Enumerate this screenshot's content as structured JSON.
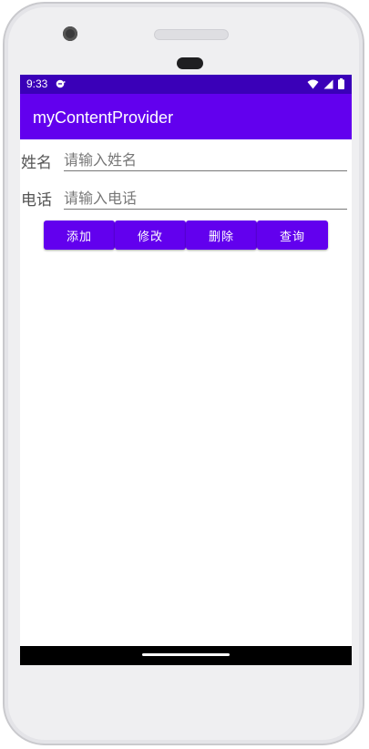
{
  "status_bar": {
    "time": "9:33"
  },
  "app_bar": {
    "title": "myContentProvider"
  },
  "form": {
    "name_label": "姓名",
    "name_placeholder": "请输入姓名",
    "phone_label": "电话",
    "phone_placeholder": "请输入电话"
  },
  "buttons": {
    "add": "添加",
    "edit": "修改",
    "delete": "删除",
    "query": "查询"
  },
  "colors": {
    "primary": "#6200ee",
    "primary_dark": "#3a00b8"
  }
}
